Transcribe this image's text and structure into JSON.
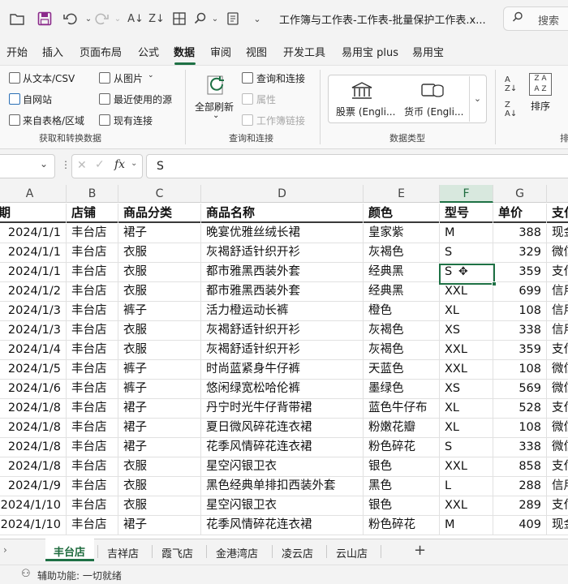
{
  "titlebar": {
    "doc_title": "工作簿与工作表-工作表-批量保护工作表.x...",
    "search_placeholder": "搜索"
  },
  "menu": {
    "items": [
      "开始",
      "插入",
      "页面布局",
      "公式",
      "数据",
      "审阅",
      "视图",
      "开发工具",
      "易用宝 plus",
      "易用宝"
    ],
    "active": "数据"
  },
  "ribbon": {
    "get_data": {
      "from_text_csv": "从文本/CSV",
      "from_web": "自网站",
      "from_table": "来自表格/区域",
      "from_picture": "从图片",
      "recent_sources": "最近使用的源",
      "existing_connections": "现有连接",
      "group_label": "获取和转换数据"
    },
    "queries": {
      "refresh_all": "全部刷新",
      "queries_connections": "查询和连接",
      "properties": "属性",
      "edit_links": "工作簿链接",
      "group_label": "查询和连接"
    },
    "datatypes": {
      "stocks": "股票 (Engli...",
      "currencies": "货币 (Engli...",
      "group_label": "数据类型"
    },
    "sort": {
      "sort_label": "排序",
      "group_label_partial": "排"
    }
  },
  "formula_bar": {
    "fx": "fx",
    "value": "S"
  },
  "columns": [
    "A",
    "B",
    "C",
    "D",
    "E",
    "F",
    "G"
  ],
  "selected_column": "F",
  "table": {
    "headers": [
      "期",
      "店铺",
      "商品分类",
      "商品名称",
      "颜色",
      "型号",
      "单价",
      "支付"
    ],
    "rows": [
      [
        "2024/1/1",
        "丰台店",
        "裙子",
        "晚宴优雅丝绒长裙",
        "皇家紫",
        "M",
        "388",
        "现金"
      ],
      [
        "2024/1/1",
        "丰台店",
        "衣服",
        "灰褐舒适针织开衫",
        "灰褐色",
        "S",
        "329",
        "微信"
      ],
      [
        "2024/1/1",
        "丰台店",
        "衣服",
        "都市雅黑西装外套",
        "经典黑",
        "S",
        "359",
        "支付"
      ],
      [
        "2024/1/2",
        "丰台店",
        "衣服",
        "都市雅黑西装外套",
        "经典黑",
        "XXL",
        "699",
        "信用"
      ],
      [
        "2024/1/3",
        "丰台店",
        "裤子",
        "活力橙运动长裤",
        "橙色",
        "XL",
        "108",
        "信用"
      ],
      [
        "2024/1/3",
        "丰台店",
        "衣服",
        "灰褐舒适针织开衫",
        "灰褐色",
        "XS",
        "338",
        "信用"
      ],
      [
        "2024/1/4",
        "丰台店",
        "衣服",
        "灰褐舒适针织开衫",
        "灰褐色",
        "XXL",
        "359",
        "支付"
      ],
      [
        "2024/1/5",
        "丰台店",
        "裤子",
        "时尚蓝紧身牛仔裤",
        "天蓝色",
        "XXL",
        "108",
        "微信"
      ],
      [
        "2024/1/6",
        "丰台店",
        "裤子",
        "悠闲绿宽松哈伦裤",
        "墨绿色",
        "XS",
        "569",
        "微信"
      ],
      [
        "2024/1/8",
        "丰台店",
        "裙子",
        "丹宁时光牛仔背带裙",
        "蓝色牛仔布",
        "XL",
        "528",
        "支付"
      ],
      [
        "2024/1/8",
        "丰台店",
        "裙子",
        "夏日微风碎花连衣裙",
        "粉嫩花瓣",
        "XL",
        "108",
        "微信"
      ],
      [
        "2024/1/8",
        "丰台店",
        "裙子",
        "花季风情碎花连衣裙",
        "粉色碎花",
        "S",
        "338",
        "微信"
      ],
      [
        "2024/1/8",
        "丰台店",
        "衣服",
        "星空闪银卫衣",
        "银色",
        "XXL",
        "858",
        "支付"
      ],
      [
        "2024/1/9",
        "丰台店",
        "衣服",
        "黑色经典单排扣西装外套",
        "黑色",
        "L",
        "288",
        "信用"
      ],
      [
        "2024/1/10",
        "丰台店",
        "衣服",
        "星空闪银卫衣",
        "银色",
        "XXL",
        "289",
        "支付"
      ],
      [
        "2024/1/10",
        "丰台店",
        "裙子",
        "花季风情碎花连衣裙",
        "粉色碎花",
        "M",
        "409",
        "现金"
      ]
    ]
  },
  "sheets": {
    "tabs": [
      "丰台店",
      "吉祥店",
      "霞飞店",
      "金港湾店",
      "凌云店",
      "云山店"
    ],
    "active": "丰台店",
    "add": "+"
  },
  "status": {
    "accessibility": "辅助功能: 一切就绪"
  },
  "colors": {
    "accent": "#1e7145",
    "selected_header_bg": "#d8e8de"
  }
}
